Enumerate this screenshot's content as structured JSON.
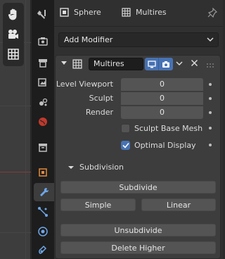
{
  "header": {
    "object_name": "Sphere",
    "modifier_crumb": "Multires"
  },
  "add_modifier": {
    "label": "Add Modifier"
  },
  "modifier": {
    "name": "Multires",
    "levels": [
      {
        "label": "Level Viewport",
        "value": "0"
      },
      {
        "label": "Sculpt",
        "value": "0"
      },
      {
        "label": "Render",
        "value": "0"
      }
    ],
    "sculpt_base_mesh": {
      "label": "Sculpt Base Mesh",
      "checked": false
    },
    "optimal_display": {
      "label": "Optimal Display",
      "checked": true
    },
    "subdivision": {
      "title": "Subdivision",
      "subdivide": "Subdivide",
      "simple": "Simple",
      "linear": "Linear",
      "unsubdivide": "Unsubdivide",
      "delete_higher": "Delete Higher"
    }
  },
  "colors": {
    "accent": "#4772b3",
    "panel": "#303030",
    "field": "#545454"
  }
}
